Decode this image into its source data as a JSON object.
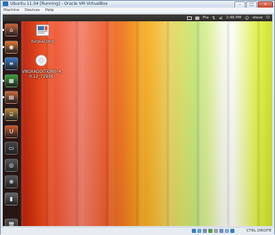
{
  "window": {
    "title": "Ubuntu 11.04 [Running] - Oracle VM VirtualBox",
    "minimize": "–",
    "maximize": "□",
    "close": "×"
  },
  "menubar": [
    "Machine",
    "Devices",
    "Help"
  ],
  "topbar": {
    "keyboard_layout": "Fra",
    "volume_icon": "speaker-icon",
    "time": "2:46 PM",
    "user": "steve"
  },
  "desktop_icons": [
    {
      "label": "turpial.png",
      "icon": "image-file-icon"
    },
    {
      "label_line1": "VBOXADDITIONS_4.",
      "label_line2": "0.12_72916",
      "icon": "cd-disc-icon"
    }
  ],
  "launcher": [
    {
      "name": "home-folder",
      "icon": "⌂",
      "color": "#c8643a"
    },
    {
      "name": "firefox",
      "icon": "◉",
      "color": "#e2762e"
    },
    {
      "name": "writer",
      "icon": "≡",
      "color": "#3a78c8"
    },
    {
      "name": "calc",
      "icon": "▦",
      "color": "#39a33a"
    },
    {
      "name": "impress",
      "icon": "▤",
      "color": "#c8683a"
    },
    {
      "name": "software-center",
      "icon": "⌸",
      "color": "#b88a3a"
    },
    {
      "name": "ubuntu-one",
      "icon": "U",
      "color": "#d1582a"
    },
    {
      "name": "terminal",
      "icon": "▭",
      "color": "#444444"
    },
    {
      "name": "workspace-switcher",
      "icon": "◎",
      "color": "#555555"
    },
    {
      "name": "dash-search",
      "icon": "⊕",
      "color": "#555555"
    },
    {
      "name": "usb-drive",
      "icon": "▮",
      "color": "#666666"
    },
    {
      "name": "trash",
      "icon": "🗑",
      "color": "#555555"
    }
  ],
  "statusbar": {
    "host_key": "CTRL DROITE",
    "icons": [
      "#3d7cc4",
      "#59a3d6",
      "#7a8ea3",
      "#4f9e4f",
      "#a0a0a0",
      "#6a8fbf",
      "#86a9d4",
      "#3d7cc4"
    ]
  }
}
